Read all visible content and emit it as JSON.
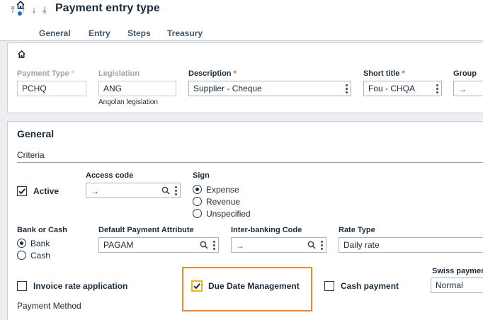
{
  "header": {
    "title": "Payment entry type",
    "nav_icons": [
      "first-record-icon",
      "previous-record-icon",
      "next-record-icon",
      "last-record-icon"
    ]
  },
  "tabs": [
    {
      "label": "General"
    },
    {
      "label": "Entry"
    },
    {
      "label": "Steps"
    },
    {
      "label": "Treasury"
    }
  ],
  "header_fields": {
    "payment_type": {
      "label": "Payment Type",
      "required": "*",
      "value": "PCHQ"
    },
    "legislation": {
      "label": "Legislation",
      "value": "ANG",
      "sub": "Angolan legislation"
    },
    "description": {
      "label": "Description",
      "required": "*",
      "value": "Supplier - Cheque"
    },
    "short_title": {
      "label": "Short title",
      "required": "*",
      "value": "Fou - CHQA"
    },
    "group": {
      "label": "Group",
      "value": "→"
    }
  },
  "general": {
    "title": "General",
    "criteria": "Criteria",
    "active": {
      "label": "Active",
      "checked": true
    },
    "access_code": {
      "label": "Access code",
      "value": "→"
    },
    "sign": {
      "label": "Sign",
      "options": [
        "Expense",
        "Revenue",
        "Unspecified"
      ],
      "selected": "Expense"
    },
    "bank_or_cash": {
      "label": "Bank or Cash",
      "options": [
        "Bank",
        "Cash"
      ],
      "selected": "Bank"
    },
    "default_payment_attribute": {
      "label": "Default Payment Attribute",
      "value": "PAGAM"
    },
    "inter_banking_code": {
      "label": "Inter-banking Code",
      "value": "→"
    },
    "rate_type": {
      "label": "Rate Type",
      "value": "Daily rate"
    },
    "invoice_rate_application": {
      "label": "Invoice rate application",
      "checked": false
    },
    "due_date_management": {
      "label": "Due Date Management",
      "checked": true
    },
    "cash_payment": {
      "label": "Cash payment",
      "checked": false
    },
    "swiss_payment": {
      "label": "Swiss paymen",
      "value": "Normal"
    },
    "payment_method": "Payment Method"
  },
  "colors": {
    "accent": "#0072c6",
    "required": "#e05a2b",
    "highlight": "#f0892e"
  }
}
